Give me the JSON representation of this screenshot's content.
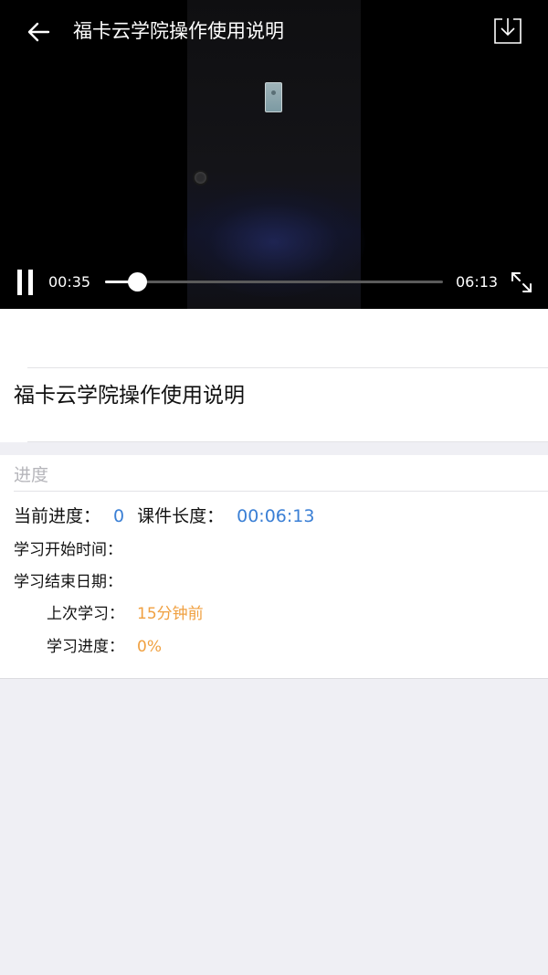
{
  "header": {
    "title": "福卡云学院操作使用说明",
    "back_icon": "arrow-left-icon",
    "download_icon": "download-icon"
  },
  "player": {
    "current_time": "00:35",
    "total_time": "06:13",
    "progress_fraction": 0.094,
    "pause_icon": "pause-icon",
    "fullscreen_icon": "fullscreen-icon"
  },
  "course": {
    "title": "福卡云学院操作使用说明"
  },
  "progress": {
    "section_label": "进度",
    "current_progress_label": "当前进度：",
    "current_progress_value": "0",
    "course_length_label": "课件长度：",
    "course_length_value": "00:06:13",
    "start_time_label": "学习开始时间：",
    "end_date_label": "学习结束日期：",
    "last_study_label": "上次学习：",
    "last_study_value": "15分钟前",
    "study_progress_label": "学习进度：",
    "study_progress_value": "0%"
  },
  "colors": {
    "accent_blue": "#3a7fd5",
    "accent_orange": "#f0a040",
    "background": "#efeff4"
  }
}
